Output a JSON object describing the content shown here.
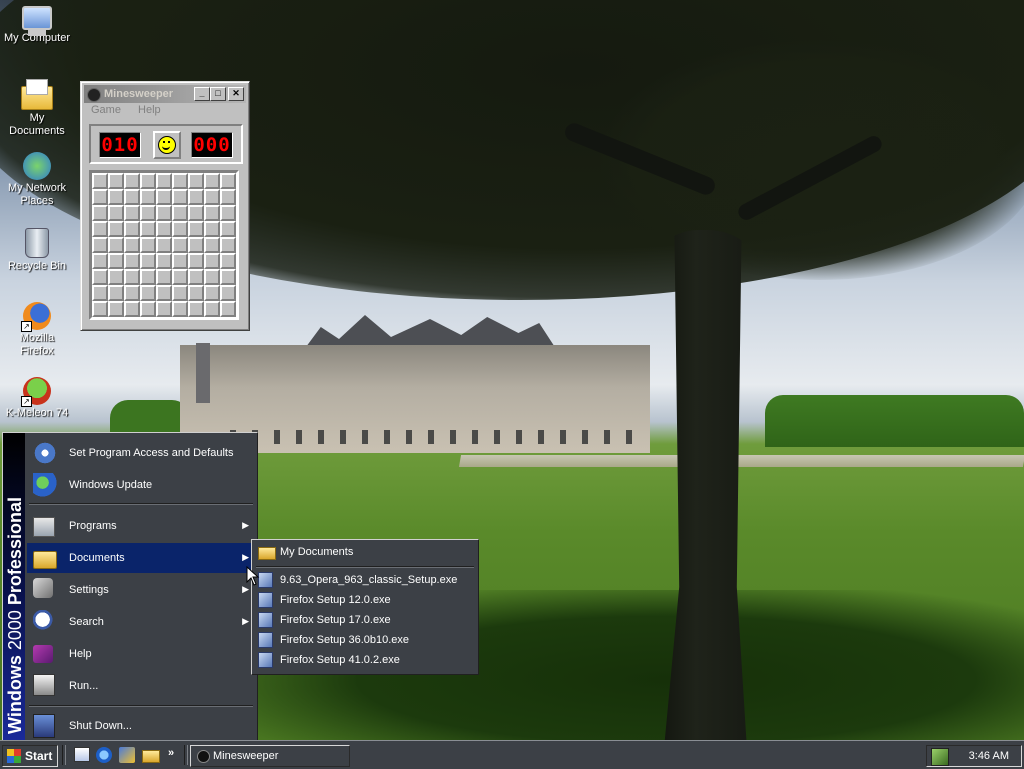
{
  "desktop": {
    "icons": [
      {
        "label": "My Computer",
        "icon": "my-computer-icon"
      },
      {
        "label": "My Documents",
        "icon": "my-documents-icon"
      },
      {
        "label": "My Network Places",
        "icon": "network-places-icon"
      },
      {
        "label": "Recycle Bin",
        "icon": "recycle-bin-icon"
      },
      {
        "label": "Mozilla Firefox",
        "icon": "firefox-icon"
      },
      {
        "label": "K-Meleon 74",
        "icon": "k-meleon-icon"
      }
    ]
  },
  "minesweeper": {
    "title": "Minesweeper",
    "menu": [
      "Game",
      "Help"
    ],
    "mines_left": "010",
    "timer": "000",
    "grid_rows": 9,
    "grid_cols": 9,
    "face": "smiley",
    "buttons": {
      "minimize": "_",
      "maximize": "□",
      "close": "✕"
    }
  },
  "start_menu": {
    "banner_bold": "Windows",
    "banner_thin": "2000",
    "banner_bold2": "Professional",
    "items": [
      {
        "label": "Set Program Access and Defaults",
        "icon": "program-access-icon",
        "submenu": false
      },
      {
        "label": "Windows Update",
        "icon": "windows-update-icon",
        "submenu": false
      },
      {
        "label": "Programs",
        "icon": "programs-icon",
        "submenu": true
      },
      {
        "label": "Documents",
        "icon": "documents-icon",
        "submenu": true,
        "active": true
      },
      {
        "label": "Settings",
        "icon": "settings-icon",
        "submenu": true
      },
      {
        "label": "Search",
        "icon": "search-icon",
        "submenu": true
      },
      {
        "label": "Help",
        "icon": "help-icon",
        "submenu": false
      },
      {
        "label": "Run...",
        "icon": "run-icon",
        "submenu": false
      },
      {
        "label": "Shut Down...",
        "icon": "shutdown-icon",
        "submenu": false
      }
    ]
  },
  "documents_submenu": {
    "items": [
      {
        "label": "My Documents",
        "icon": "folder-icon"
      },
      {
        "label": "9.63_Opera_963_classic_Setup.exe",
        "icon": "exe-icon"
      },
      {
        "label": "Firefox Setup 12.0.exe",
        "icon": "exe-icon"
      },
      {
        "label": "Firefox Setup 17.0.exe",
        "icon": "exe-icon"
      },
      {
        "label": "Firefox Setup 36.0b10.exe",
        "icon": "exe-icon"
      },
      {
        "label": "Firefox Setup 41.0.2.exe",
        "icon": "exe-icon"
      }
    ]
  },
  "taskbar": {
    "start_label": "Start",
    "quick_launch": [
      "show-desktop-icon",
      "internet-explorer-icon",
      "outlook-express-icon",
      "explorer-icon"
    ],
    "more": "»",
    "tasks": [
      {
        "label": "Minesweeper"
      }
    ],
    "clock": "3:46 AM"
  },
  "colors": {
    "menu_bg": "#3c4046",
    "highlight": "#0a246a",
    "lcd_red": "#ff0000"
  }
}
